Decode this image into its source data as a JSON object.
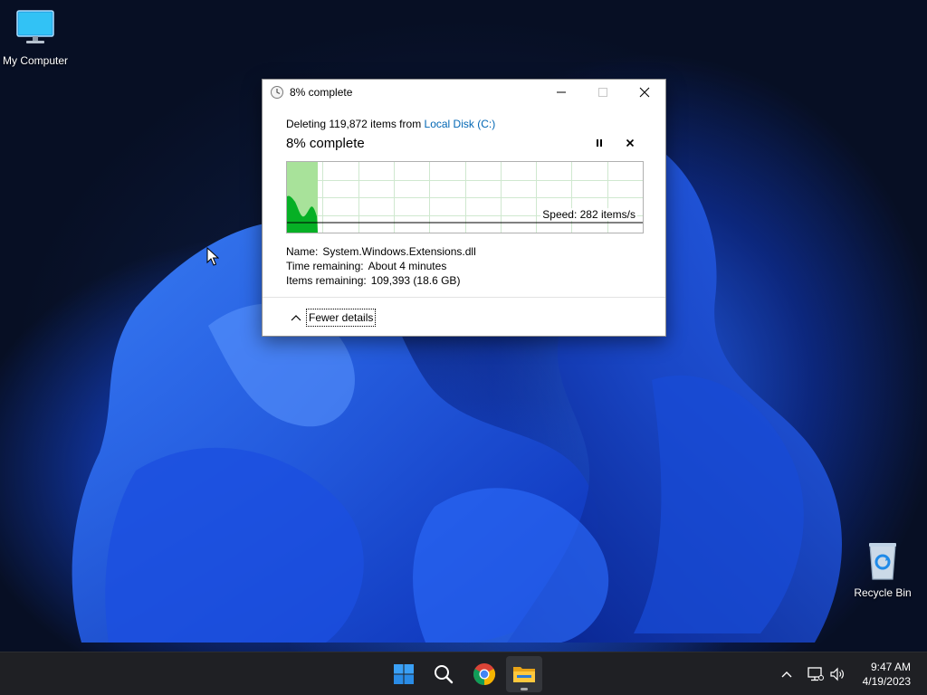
{
  "desktop": {
    "icons": [
      {
        "label": "My Computer",
        "icon": "monitor-icon"
      },
      {
        "label": "Recycle Bin",
        "icon": "recycle-bin-icon"
      }
    ]
  },
  "dialog": {
    "title": "8% complete",
    "status_prefix": "Deleting 119,872 items from ",
    "status_link": "Local Disk (C:)",
    "big_status": "8% complete",
    "progress_fraction": 0.08,
    "speed": "Speed: 282 items/s",
    "details": [
      {
        "key": "Name:",
        "value": "System.Windows.Extensions.dll"
      },
      {
        "key": "Time remaining:",
        "value": "About 4 minutes"
      },
      {
        "key": "Items remaining:",
        "value": "109,393 (18.6 GB)"
      }
    ],
    "fewer_details": "Fewer details",
    "accent_progress": "#06b025"
  },
  "taskbar": {
    "apps": [
      {
        "name": "Start",
        "icon": "windows-logo-icon"
      },
      {
        "name": "Search",
        "icon": "search-icon"
      },
      {
        "name": "Google Chrome",
        "icon": "chrome-icon"
      },
      {
        "name": "File Explorer",
        "icon": "folder-icon"
      }
    ],
    "time": "9:47 AM",
    "date": "4/19/2023"
  }
}
